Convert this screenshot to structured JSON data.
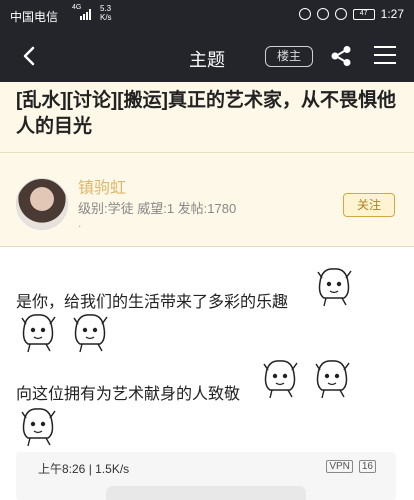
{
  "status_bar": {
    "carrier": "中国电信",
    "signal_label": "4G",
    "speed": "5.3",
    "speed_unit": "K/s",
    "battery": "47",
    "time": "1:27"
  },
  "nav": {
    "title": "主题",
    "owner_button": "楼主"
  },
  "post": {
    "title": "[乱水][讨论][搬运]真正的艺术家，从不畏惧他人的目光"
  },
  "author": {
    "name": "镇驹虹",
    "level_line": "级别:学徒 威望:1 发帖:1780",
    "extra": ".",
    "follow_label": "关注"
  },
  "content": {
    "line1": "是你，给我们的生活带来了多彩的乐趣",
    "line2": "向这位拥有为艺术献身的人致敬",
    "embedded_time": "上午8:26 | 1.5K/s",
    "embedded_badge_vpn": "VPN",
    "embedded_battery": "16"
  },
  "icons": {
    "back": "chevron-left-icon",
    "share": "share-icon",
    "menu": "hamburger-menu-icon",
    "sticker": "anime-girl-sticker-icon"
  },
  "colors": {
    "header_bg": "#23252a",
    "page_bg": "#fdf8e8",
    "author_name": "#e0b66a",
    "follow_border": "#d6a93f"
  }
}
